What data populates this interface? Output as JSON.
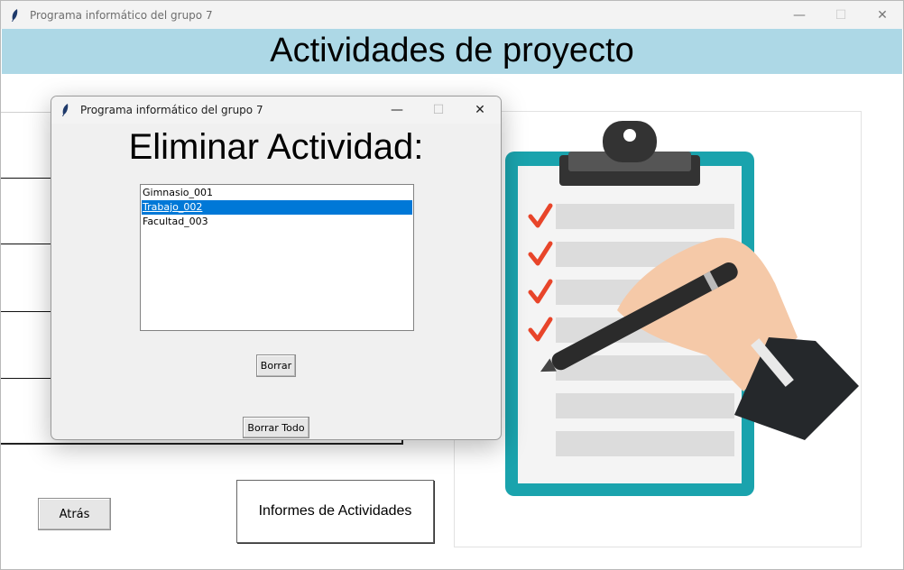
{
  "main_window": {
    "title": "Programa informático del grupo 7",
    "controls": {
      "minimize": "—",
      "maximize": "☐",
      "close": "✕"
    }
  },
  "header": {
    "title": "Actividades de proyecto",
    "background": "#add8e6"
  },
  "buttons": {
    "atras": "Atrás",
    "informes": "Informes de Actividades"
  },
  "dialog": {
    "title": "Programa informático del grupo 7",
    "heading": "Eliminar Actividad:",
    "list": {
      "items": [
        "Gimnasio_001",
        "Trabajo_002",
        "Facultad_003"
      ],
      "selected_index": 1,
      "selected_color": "#0078d7"
    },
    "borrar_label": "Borrar",
    "borrar_todo_label": "Borrar Todo"
  },
  "illustration": {
    "subject": "clipboard-checklist-with-hand-and-pen",
    "clipboard_color": "#1aa3ad",
    "check_color": "#e8452a"
  }
}
